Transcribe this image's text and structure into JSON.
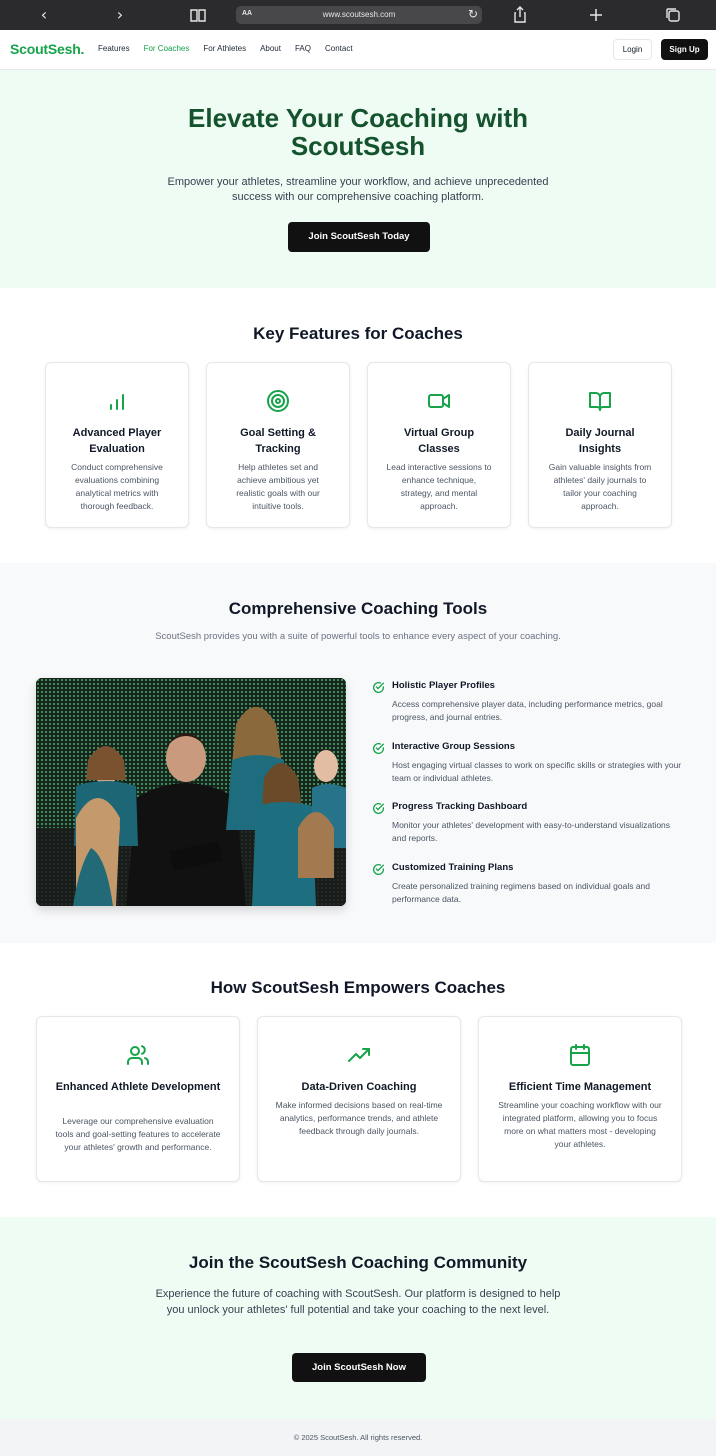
{
  "browser": {
    "text_size_label": "AA",
    "url": "www.scoutsesh.com"
  },
  "nav": {
    "logo": "ScoutSesh.",
    "links": [
      {
        "label": "Features"
      },
      {
        "label": "For Coaches"
      },
      {
        "label": "For Athletes"
      },
      {
        "label": "About"
      },
      {
        "label": "FAQ"
      },
      {
        "label": "Contact"
      }
    ],
    "active_link": "For Coaches",
    "login": "Login",
    "signup": "Sign Up"
  },
  "hero": {
    "title": "Elevate Your Coaching with ScoutSesh",
    "subtitle": "Empower your athletes, streamline your workflow, and achieve unprecedented success with our comprehensive coaching platform.",
    "cta": "Join ScoutSesh Today"
  },
  "key_features": {
    "title": "Key Features for Coaches",
    "cards": [
      {
        "icon": "bar-chart-icon",
        "title": "Advanced Player Evaluation",
        "text": "Conduct comprehensive evaluations combining analytical metrics with thorough feedback."
      },
      {
        "icon": "target-icon",
        "title": "Goal Setting & Tracking",
        "text": "Help athletes set and achieve ambitious yet realistic goals with our intuitive tools."
      },
      {
        "icon": "video-icon",
        "title": "Virtual Group Classes",
        "text": "Lead interactive sessions to enhance technique, strategy, and mental approach."
      },
      {
        "icon": "book-open-icon",
        "title": "Daily Journal Insights",
        "text": "Gain valuable insights from athletes' daily journals to tailor your coaching approach."
      }
    ]
  },
  "tools": {
    "title": "Comprehensive Coaching Tools",
    "subtitle": "ScoutSesh provides you with a suite of powerful tools to enhance every aspect of your coaching.",
    "items": [
      {
        "title": "Holistic Player Profiles",
        "text": "Access comprehensive player data, including performance metrics, goal progress, and journal entries."
      },
      {
        "title": "Interactive Group Sessions",
        "text": "Host engaging virtual classes to work on specific skills or strategies with your team or individual athletes."
      },
      {
        "title": "Progress Tracking Dashboard",
        "text": "Monitor your athletes' development with easy-to-understand visualizations and reports."
      },
      {
        "title": "Customized Training Plans",
        "text": "Create personalized training regimens based on individual goals and performance data."
      }
    ]
  },
  "empower": {
    "title": "How ScoutSesh Empowers Coaches",
    "cards": [
      {
        "icon": "users-icon",
        "title": "Enhanced Athlete Development",
        "text": "Leverage our comprehensive evaluation tools and goal-setting features to accelerate your athletes' growth and performance."
      },
      {
        "icon": "trending-up-icon",
        "title": "Data-Driven Coaching",
        "text": "Make informed decisions based on real-time analytics, performance trends, and athlete feedback through daily journals."
      },
      {
        "icon": "calendar-icon",
        "title": "Efficient Time Management",
        "text": "Streamline your coaching workflow with our integrated platform, allowing you to focus more on what matters most - developing your athletes."
      }
    ]
  },
  "community": {
    "title": "Join the ScoutSesh Coaching Community",
    "text": "Experience the future of coaching with ScoutSesh. Our platform is designed to help you unlock your athletes' full potential and take your coaching to the next level.",
    "cta": "Join ScoutSesh Now"
  },
  "footer": {
    "text": "© 2025 ScoutSesh. All rights reserved."
  },
  "colors": {
    "brand_green": "#16a34a",
    "dark_green": "#14532d",
    "hero_bg": "#effcf3",
    "button_dark": "#111111"
  }
}
